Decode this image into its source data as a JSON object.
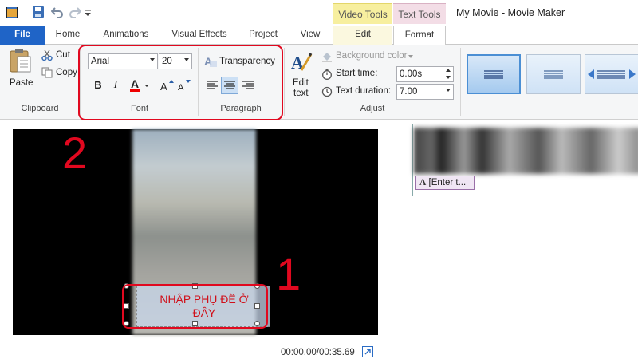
{
  "window": {
    "title": "My Movie - Movie Maker"
  },
  "context_tabs": {
    "video_tools": "Video Tools",
    "text_tools": "Text Tools"
  },
  "tabs": {
    "file": "File",
    "home": "Home",
    "animations": "Animations",
    "visual_effects": "Visual Effects",
    "project": "Project",
    "view": "View",
    "edit": "Edit",
    "format": "Format"
  },
  "clipboard": {
    "paste": "Paste",
    "cut": "Cut",
    "copy": "Copy",
    "label": "Clipboard"
  },
  "font": {
    "family": "Arial",
    "size": "20",
    "label": "Font"
  },
  "paragraph": {
    "transparency": "Transparency",
    "label": "Paragraph"
  },
  "adjust": {
    "edit_text": "Edit",
    "edit_text_2": "text",
    "background_color": "Background color",
    "start_time_label": "Start time:",
    "start_time_value": "0.00s",
    "duration_label": "Text duration:",
    "duration_value": "7.00",
    "label": "Adjust"
  },
  "preview": {
    "caption_line1": "NHẬP PHỤ ĐỀ Ở",
    "caption_line2": "ĐÂY",
    "timecode": "00:00.00/00:35.69"
  },
  "storyboard": {
    "text_clip": "[Enter t..."
  },
  "annotations": {
    "marker_1": "1",
    "marker_2": "2"
  },
  "colors": {
    "file_tab": "#1f64c7",
    "video_tools": "#f7ef9f",
    "text_tools": "#f3dde6",
    "highlight": "#e1081f",
    "caption_text": "#d0101a"
  }
}
